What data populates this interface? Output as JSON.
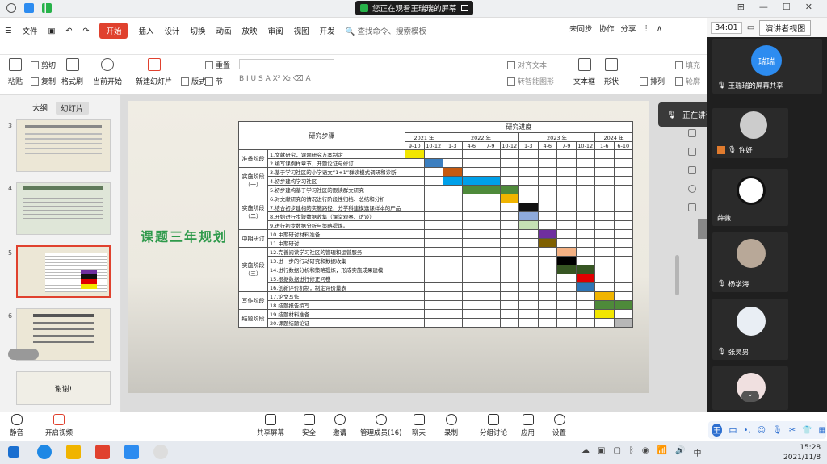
{
  "titlebar": {
    "share_status": "您正在观看王瑞瑞的屏幕"
  },
  "menu": {
    "file": "文件",
    "items": [
      "开始",
      "插入",
      "设计",
      "切换",
      "动画",
      "放映",
      "审阅",
      "视图",
      "开发"
    ],
    "search_placeholder": "查找命令、搜索模板",
    "unsynced": "未同步",
    "collab": "协作",
    "share": "分享"
  },
  "ribbon": {
    "paste": "粘贴",
    "cut": "剪切",
    "copy": "复制",
    "format_painter": "格式刷",
    "play_from_current": "当前开始",
    "new_slide": "新建幻灯片",
    "layout": "版式",
    "section": "节",
    "reset": "重置",
    "align_text": "对齐文本",
    "convert_smartart": "转智能图形",
    "textbox": "文本框",
    "shape": "形状",
    "arrange": "排列",
    "fill": "填充",
    "outline": "轮廓"
  },
  "timer": "34:01",
  "presenter_view": "演讲者视图",
  "panel": {
    "tabs": [
      "大纲",
      "幻灯片"
    ],
    "thumb_numbers": [
      "3",
      "4",
      "5",
      "6"
    ],
    "last_thumb_text": "谢谢!"
  },
  "slide": {
    "title": "课题三年规划",
    "header_steps": "研究步骤",
    "header_progress": "研究进度",
    "years": [
      "2021 年",
      "2022 年",
      "2023 年",
      "2024 年"
    ],
    "months": [
      "9-10",
      "10-12",
      "1-3",
      "4-6",
      "7-9",
      "10-12",
      "1-3",
      "4-6",
      "7-9",
      "10-12",
      "1-6",
      "6-10"
    ],
    "stages": [
      {
        "name": "准备阶段",
        "rows": 2
      },
      {
        "name": "实施阶段（一）",
        "rows": 3
      },
      {
        "name": "实施阶段（二）",
        "rows": 4
      },
      {
        "name": "中期研讨",
        "rows": 2
      },
      {
        "name": "实施阶段（三）",
        "rows": 5
      },
      {
        "name": "写作阶段",
        "rows": 2
      },
      {
        "name": "结题阶段",
        "rows": 2
      }
    ],
    "steps": [
      "1.文献研究，课题研究方案制定",
      "2.编写课例样章节，开题论证与修订",
      "3.基于学习社区的小学语文“1+1”群读模式调研和诊断",
      "4.初步建构学习社区",
      "5.初步建构基于学习社区的跟读群文研究",
      "6.对文献研究的情况进行阶段性归档、总结和分析",
      "7.结合初步建构的实施路径，分学科建模选课样本的产品",
      "8.开始进行步骤数据收集（课堂观察、访谈）",
      "9.进行初步数据分析与策略提炼。",
      "10.中期研讨材料准备",
      "11.中期研讨",
      "12.完善阅读学习社区的管理和运营服务",
      "13.进一步的行动研究和数据收集",
      "14.进行数据分析和策略提炼，形成实施成果建模",
      "15.根据数据进行修正问卷",
      "16.创新评价机制，制定评价量表",
      "17.论文写作",
      "18.结题报告撰写",
      "19.结题材料准备",
      "20.课题结题论证"
    ],
    "bars": [
      {
        "row": 0,
        "start": 0,
        "len": 1,
        "color": "#f2e600"
      },
      {
        "row": 1,
        "start": 1,
        "len": 1,
        "color": "#3c7fc0"
      },
      {
        "row": 2,
        "start": 2,
        "len": 1,
        "color": "#c55a11"
      },
      {
        "row": 3,
        "start": 2,
        "len": 3,
        "color": "#00a0e9"
      },
      {
        "row": 4,
        "start": 3,
        "len": 3,
        "color": "#4e8a3a"
      },
      {
        "row": 5,
        "start": 5,
        "len": 1,
        "color": "#f0b400"
      },
      {
        "row": 6,
        "start": 6,
        "len": 1,
        "color": "#111111"
      },
      {
        "row": 7,
        "start": 6,
        "len": 1,
        "color": "#8eaadb"
      },
      {
        "row": 8,
        "start": 6,
        "len": 1,
        "color": "#c5e0b4"
      },
      {
        "row": 9,
        "start": 7,
        "len": 1,
        "color": "#6f2f9f"
      },
      {
        "row": 10,
        "start": 7,
        "len": 1,
        "color": "#7f6000"
      },
      {
        "row": 11,
        "start": 8,
        "len": 1,
        "color": "#f4b183"
      },
      {
        "row": 12,
        "start": 8,
        "len": 1,
        "color": "#000000"
      },
      {
        "row": 13,
        "start": 8,
        "len": 2,
        "color": "#375623"
      },
      {
        "row": 14,
        "start": 9,
        "len": 1,
        "color": "#e00000"
      },
      {
        "row": 15,
        "start": 9,
        "len": 1,
        "color": "#2e75b6"
      },
      {
        "row": 16,
        "start": 10,
        "len": 1,
        "color": "#f0b400"
      },
      {
        "row": 17,
        "start": 10,
        "len": 2,
        "color": "#4e8a3a"
      },
      {
        "row": 18,
        "start": 10,
        "len": 1,
        "color": "#f2e600"
      },
      {
        "row": 19,
        "start": 11,
        "len": 1,
        "color": "#b7b7b7"
      }
    ]
  },
  "meeting": {
    "speaking": "正在讲话: 王瑞瑞:",
    "participants": [
      {
        "name": "王瑞瑞的屏幕共享",
        "avatar_text": "瑞瑞",
        "color": "#2d8cf0"
      },
      {
        "name": "许好",
        "avatar_text": "",
        "color": "#cccccc"
      },
      {
        "name": "薛薇",
        "avatar_text": "",
        "color": "#dddddd"
      },
      {
        "name": "杨学海",
        "avatar_text": "",
        "color": "#b8a898"
      },
      {
        "name": "张昊男",
        "avatar_text": "",
        "color": "#e9eef4"
      },
      {
        "name": "",
        "avatar_text": "",
        "color": "#f0e0e0"
      }
    ]
  },
  "bottom": {
    "mute": "静音",
    "video": "开启视频",
    "share": "共享屏幕",
    "security": "安全",
    "invite": "邀请",
    "members": "管理成员(16)",
    "chat": "聊天",
    "record": "录制",
    "breakout": "分组讨论",
    "apps": "应用",
    "settings": "设置"
  },
  "clock": {
    "time": "15:28",
    "date": "2021/11/8"
  }
}
